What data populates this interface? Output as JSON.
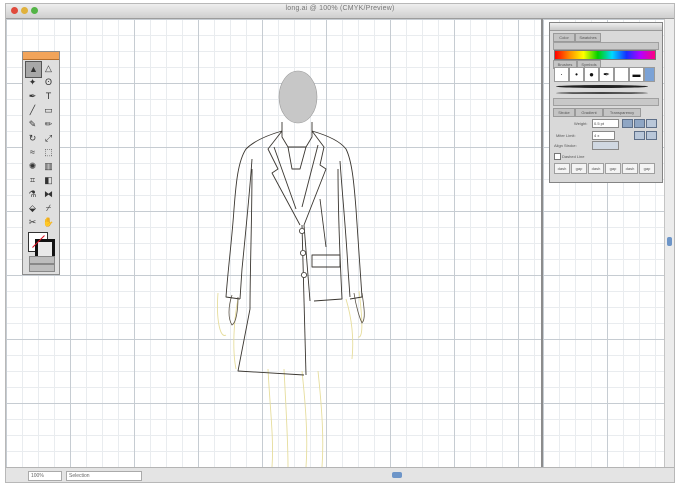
{
  "window": {
    "title": "long.ai @ 100% (CMYK/Preview)",
    "traffic_light_colors": [
      "#e04a3c",
      "#e0b13c",
      "#53b446"
    ]
  },
  "status_bar": {
    "zoom_value": "100%",
    "artboard_label": "Selection"
  },
  "colors": {
    "toolbox_header": "#f2a45a",
    "scroll_thumb": "#6d95c8",
    "garment_outline": "#3a3630",
    "figure_sketch": "#e6dd9c",
    "head_fill": "#c7c7c7"
  },
  "toolbox": {
    "tools": [
      {
        "name": "selection-tool-icon",
        "glyph": "▲"
      },
      {
        "name": "direct-selection-tool-icon",
        "glyph": "△"
      },
      {
        "name": "magic-wand-tool-icon",
        "glyph": "✦"
      },
      {
        "name": "lasso-tool-icon",
        "glyph": "ʘ"
      },
      {
        "name": "pen-tool-icon",
        "glyph": "✒"
      },
      {
        "name": "type-tool-icon",
        "glyph": "T"
      },
      {
        "name": "line-tool-icon",
        "glyph": "╱"
      },
      {
        "name": "rectangle-tool-icon",
        "glyph": "▭"
      },
      {
        "name": "paintbrush-tool-icon",
        "glyph": "✎"
      },
      {
        "name": "pencil-tool-icon",
        "glyph": "✏"
      },
      {
        "name": "rotate-tool-icon",
        "glyph": "↻"
      },
      {
        "name": "scale-tool-icon",
        "glyph": "⤢"
      },
      {
        "name": "warp-tool-icon",
        "glyph": "≈"
      },
      {
        "name": "free-transform-tool-icon",
        "glyph": "⬚"
      },
      {
        "name": "symbol-sprayer-tool-icon",
        "glyph": "✺"
      },
      {
        "name": "graph-tool-icon",
        "glyph": "▥"
      },
      {
        "name": "mesh-tool-icon",
        "glyph": "⌗"
      },
      {
        "name": "gradient-tool-icon",
        "glyph": "◧"
      },
      {
        "name": "eyedropper-tool-icon",
        "glyph": "⚗"
      },
      {
        "name": "blend-tool-icon",
        "glyph": "⧓"
      },
      {
        "name": "live-paint-tool-icon",
        "glyph": "⬙"
      },
      {
        "name": "slice-tool-icon",
        "glyph": "⌿"
      },
      {
        "name": "scissors-tool-icon",
        "glyph": "✂"
      },
      {
        "name": "hand-tool-icon",
        "glyph": "✋"
      }
    ]
  },
  "panel": {
    "tabs": [
      "Color",
      "Swatches"
    ],
    "brush_tabs": [
      "Brushes",
      "Symbols"
    ],
    "stroke_tabs": [
      "Stroke",
      "Gradient",
      "Transparency"
    ],
    "weight_label": "Weight:",
    "weight_value": "0.5 pt",
    "miter_label": "Miter Limit:",
    "miter_value": "4 x",
    "align_label": "Align Stroke:",
    "dashed_label": "Dashed Line",
    "dash_cells": [
      "dash",
      "gap",
      "dash",
      "gap",
      "dash",
      "gap"
    ]
  }
}
